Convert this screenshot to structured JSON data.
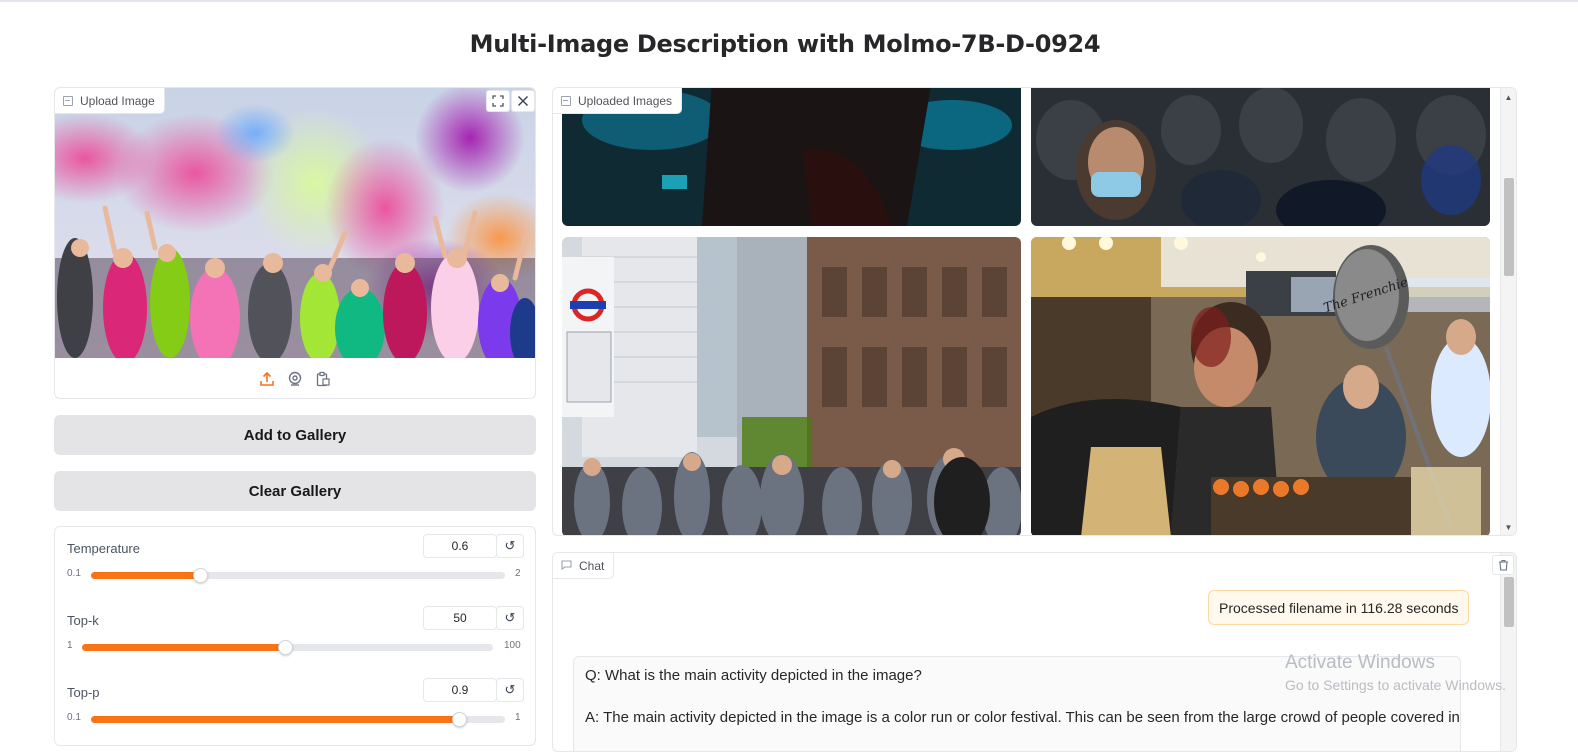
{
  "page_title": "Multi-Image Description with Molmo-7B-D-0924",
  "upload": {
    "label": "Upload Image",
    "icons": [
      "upload-icon",
      "webcam-icon",
      "clipboard-icon",
      "fullscreen-icon",
      "close-icon"
    ]
  },
  "buttons": {
    "add_to_gallery": "Add to Gallery",
    "clear_gallery": "Clear Gallery"
  },
  "sliders": [
    {
      "label": "Temperature",
      "value": "0.6",
      "min": "0.1",
      "max": "2",
      "fraction": 0.263
    },
    {
      "label": "Top-k",
      "value": "50",
      "min": "1",
      "max": "100",
      "fraction": 0.495
    },
    {
      "label": "Top-p",
      "value": "0.9",
      "min": "0.1",
      "max": "1",
      "fraction": 0.889
    }
  ],
  "gallery": {
    "label": "Uploaded Images",
    "images": [
      "dark-figure-blue-light",
      "crowd-with-mask",
      "london-street-crowd",
      "market-vendor-frenchie"
    ],
    "sign_text": "The Frenchie"
  },
  "chat": {
    "label": "Chat",
    "status": "Processed filename in 116.28 seconds",
    "question": "Q: What is the main activity depicted in the image?",
    "answer": "A: The main activity depicted in the image is a color run or color festival. This can be seen from the large crowd of people covered in"
  },
  "watermark": {
    "line1": "Activate Windows",
    "line2": "Go to Settings to activate Windows."
  },
  "colors": {
    "accent": "#f97316",
    "button_bg": "#e4e4e7",
    "status_bg": "#fef9ec"
  }
}
